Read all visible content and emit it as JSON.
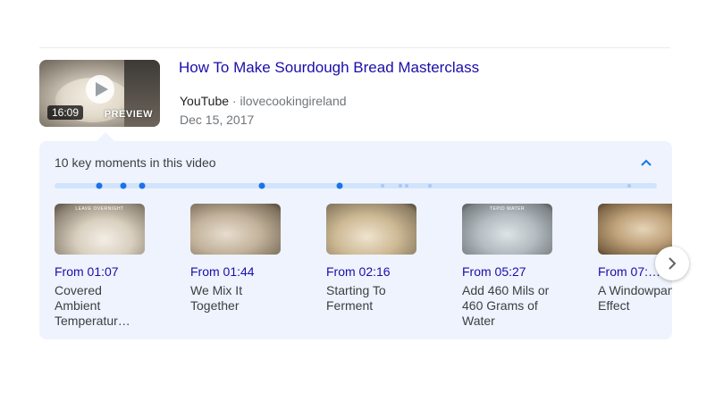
{
  "video": {
    "title": "How To Make Sourdough Bread Masterclass",
    "duration": "16:09",
    "preview_label": "PREVIEW",
    "site": "YouTube",
    "separator": "·",
    "channel": "ilovecookingireland",
    "date": "Dec 15, 2017"
  },
  "key_moments": {
    "heading": "10 key moments in this video",
    "items": [
      {
        "time_label": "From 01:07",
        "caption": "Covered Ambient Temperatur…",
        "thumb_text": "LEAVE OVERNIGHT"
      },
      {
        "time_label": "From 01:44",
        "caption": "We Mix It Together",
        "thumb_text": ""
      },
      {
        "time_label": "From 02:16",
        "caption": "Starting To Ferment",
        "thumb_text": ""
      },
      {
        "time_label": "From 05:27",
        "caption": "Add 460 Mils or 460 Grams of Water",
        "thumb_text": "TEPID WATER"
      },
      {
        "time_label": "From 07:…",
        "caption": "A Windowpane Effect",
        "thumb_text": ""
      }
    ]
  },
  "icons": {
    "play": "play-icon",
    "collapse": "chevron-up-icon",
    "next": "chevron-right-icon"
  },
  "colors": {
    "link": "#1a0dab",
    "accent": "#1a73e8",
    "panel_bg": "#eef3fd"
  }
}
